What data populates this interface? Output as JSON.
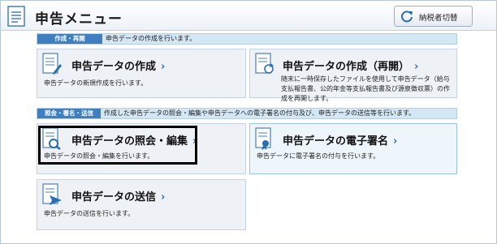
{
  "header": {
    "title": "申告メニュー",
    "switch_label": "納税者切替"
  },
  "sections": [
    {
      "tag": "作成・再開",
      "description": "申告データの作成を行います。"
    },
    {
      "tag": "照会・署名・送信",
      "description": "作成した申告データの照会・編集や申告データへの電子署名の付与及び、申告データの送信等を行います。"
    }
  ],
  "cards": {
    "create": {
      "title": "申告データの作成",
      "desc": "申告データの新規作成を行います。"
    },
    "resume": {
      "title": "申告データの作成（再開）",
      "desc": "随末に一時保存したファイルを使用して申告データ（給与支払報告書、公的年金等支払報告書及び源泉徴収票）の作成を再開します。"
    },
    "edit": {
      "title": "申告データの照会・編集",
      "desc": "申告データの照会・編集を行います。"
    },
    "sign": {
      "title": "申告データの電子署名",
      "desc": "申告データに電子署名の付与を行います。"
    },
    "send": {
      "title": "申告データの送信",
      "desc": "申告データの送信を行います。"
    }
  },
  "chevron": "›",
  "icons": [
    "document-icon",
    "refresh-icon",
    "document-edit-icon",
    "document-resume-icon",
    "document-view-icon",
    "document-sign-icon",
    "document-send-icon"
  ],
  "colors": {
    "section_tag": "#3f7fc0",
    "section_bar": "#d3e7f4",
    "card_bg": "#eef2f6",
    "chevron": "#2a6db5"
  }
}
